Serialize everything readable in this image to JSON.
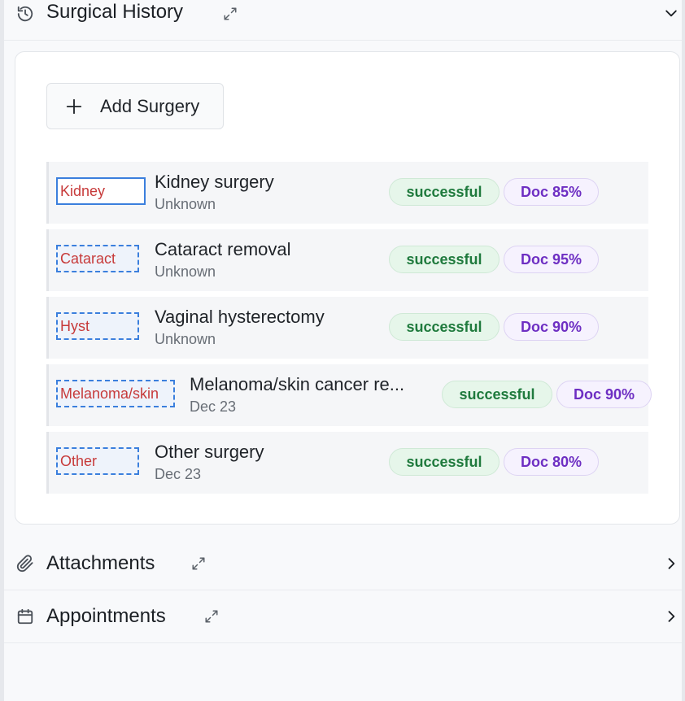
{
  "surgical_history": {
    "title": "Surgical History",
    "add_button_label": "Add Surgery",
    "rows": [
      {
        "tag": "Kidney",
        "title": "Kidney surgery",
        "date": "Unknown",
        "status": "successful",
        "doc": "Doc 85%"
      },
      {
        "tag": "Cataract",
        "title": "Cataract removal",
        "date": "Unknown",
        "status": "successful",
        "doc": "Doc 95%"
      },
      {
        "tag": "Hyst",
        "title": "Vaginal hysterectomy",
        "date": "Unknown",
        "status": "successful",
        "doc": "Doc 90%"
      },
      {
        "tag": "Melanoma/skin",
        "title": "Melanoma/skin cancer re...",
        "date": "Dec 23",
        "status": "successful",
        "doc": "Doc 90%"
      },
      {
        "tag": "Other",
        "title": "Other surgery",
        "date": "Dec 23",
        "status": "successful",
        "doc": "Doc 80%"
      }
    ]
  },
  "attachments": {
    "title": "Attachments"
  },
  "appointments": {
    "title": "Appointments"
  },
  "icons": {
    "history": "history-icon",
    "expand": "expand-icon",
    "chevron_down": "chevron-down-icon",
    "chevron_right": "chevron-right-icon",
    "paperclip": "paperclip-icon",
    "calendar": "calendar-icon",
    "plus": "plus-icon"
  },
  "colors": {
    "status_text": "#1f7a3d",
    "status_bg": "#e6f6ea",
    "doc_text": "#6e2fc3",
    "doc_bg": "#f6f2fe",
    "tag_text": "#c73a3a",
    "tag_border": "#3b7fdd"
  }
}
